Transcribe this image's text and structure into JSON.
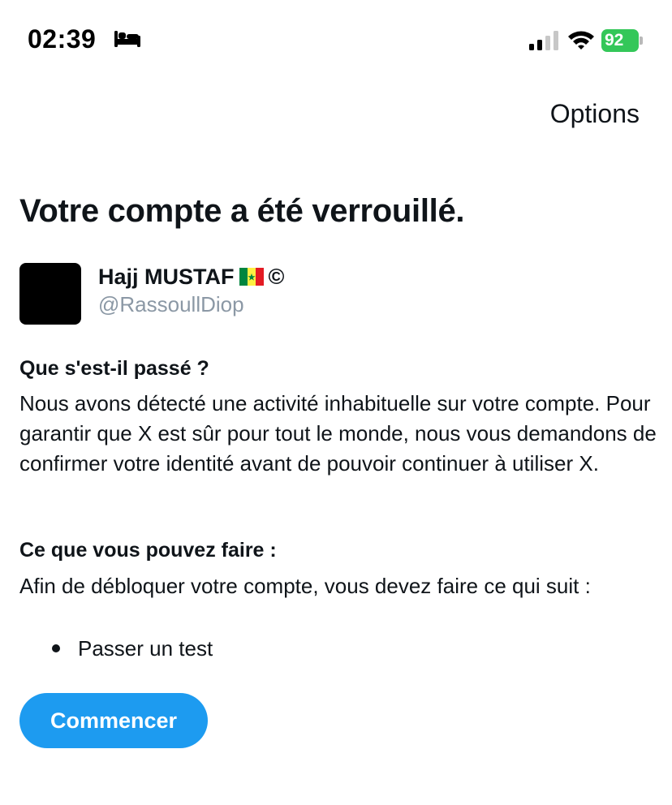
{
  "status_bar": {
    "time": "02:39",
    "battery_level": "92",
    "icons": [
      "bed-icon",
      "signal-icon",
      "wifi-icon",
      "battery-icon"
    ],
    "battery_color": "#34c759"
  },
  "header": {
    "options_label": "Options"
  },
  "page": {
    "title": "Votre compte a été verrouillé."
  },
  "user": {
    "name": "Hajj MUSTAF",
    "handle": "@RassoullDiop",
    "flag_icon": "senegal-flag-icon",
    "copyright_glyph": "©"
  },
  "sections": {
    "what_happened": {
      "heading": "Que s'est-il passé ?",
      "body": "Nous avons détecté une activité inhabituelle sur votre compte. Pour garantir que X est sûr pour tout le monde, nous vous demandons de confirmer votre identité avant de pouvoir continuer à utiliser X."
    },
    "what_to_do": {
      "heading": "Ce que vous pouvez faire :",
      "body": "Afin de débloquer votre compte, vous devez faire ce qui suit :",
      "steps": [
        "Passer un test"
      ]
    }
  },
  "actions": {
    "start_label": "Commencer",
    "accent_color": "#1d9bf0"
  }
}
